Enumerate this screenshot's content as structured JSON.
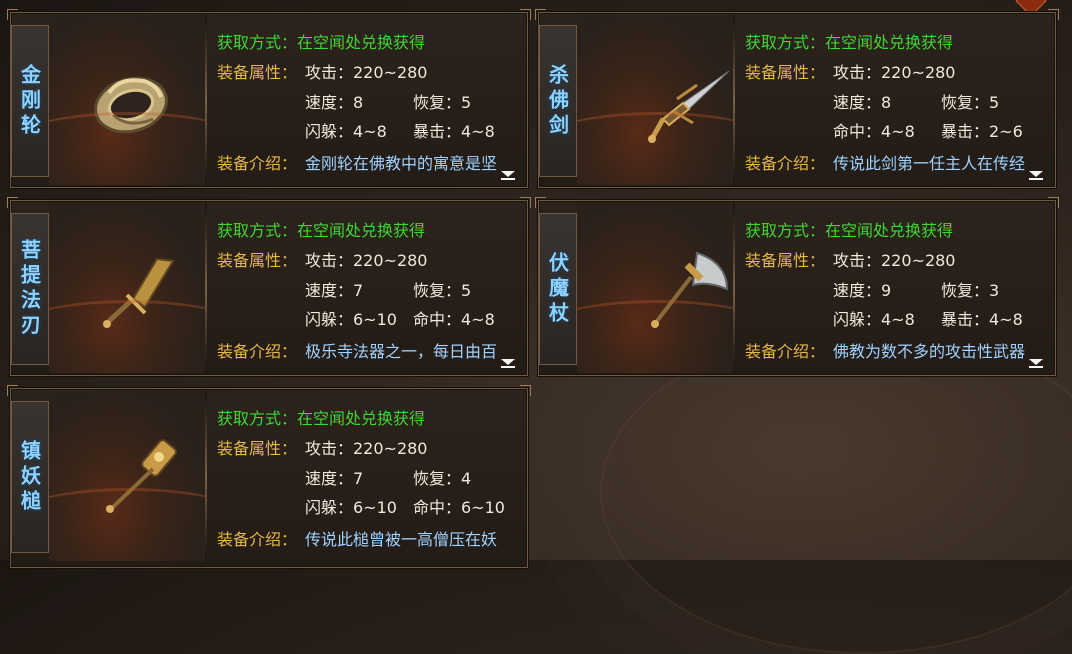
{
  "labels": {
    "obtain": "获取方式：",
    "attributes": "装备属性：",
    "intro": "装备介绍："
  },
  "items": [
    {
      "name": "金刚轮",
      "icon": "golden-ring-weapon-icon",
      "obtain": "在空闻处兑换获得",
      "attack": "攻击：220~280",
      "stats": [
        "速度：8",
        "恢复：5",
        "闪躲：4~8",
        "暴击：4~8"
      ],
      "desc": "金刚轮在佛教中的寓意是坚"
    },
    {
      "name": "杀佛剑",
      "icon": "sword-weapon-icon",
      "obtain": "在空闻处兑换获得",
      "attack": "攻击：220~280",
      "stats": [
        "速度：8",
        "恢复：5",
        "命中：4~8",
        "暴击：2~6"
      ],
      "desc": "传说此剑第一任主人在传经"
    },
    {
      "name": "菩提法刃",
      "icon": "broad-blade-weapon-icon",
      "obtain": "在空闻处兑换获得",
      "attack": "攻击：220~280",
      "stats": [
        "速度：7",
        "恢复：5",
        "闪躲：6~10",
        "命中：4~8"
      ],
      "desc": "极乐寺法器之一，每日由百"
    },
    {
      "name": "伏魔杖",
      "icon": "axe-staff-weapon-icon",
      "obtain": "在空闻处兑换获得",
      "attack": "攻击：220~280",
      "stats": [
        "速度：9",
        "恢复：3",
        "闪躲：4~8",
        "暴击：4~8"
      ],
      "desc": "佛教为数不多的攻击性武器"
    },
    {
      "name": "镇妖槌",
      "icon": "hammer-weapon-icon",
      "obtain": "在空闻处兑换获得",
      "attack": "攻击：220~280",
      "stats": [
        "速度：7",
        "恢复：4",
        "闪躲：6~10",
        "命中：6~10"
      ],
      "desc": "传说此槌曾被一高僧压在妖"
    }
  ],
  "colors": {
    "obtain": "#3fd633",
    "label": "#e6b84a",
    "value": "#f0e8dc",
    "desc": "#9fd2ff",
    "name": "#8ed3ff"
  }
}
